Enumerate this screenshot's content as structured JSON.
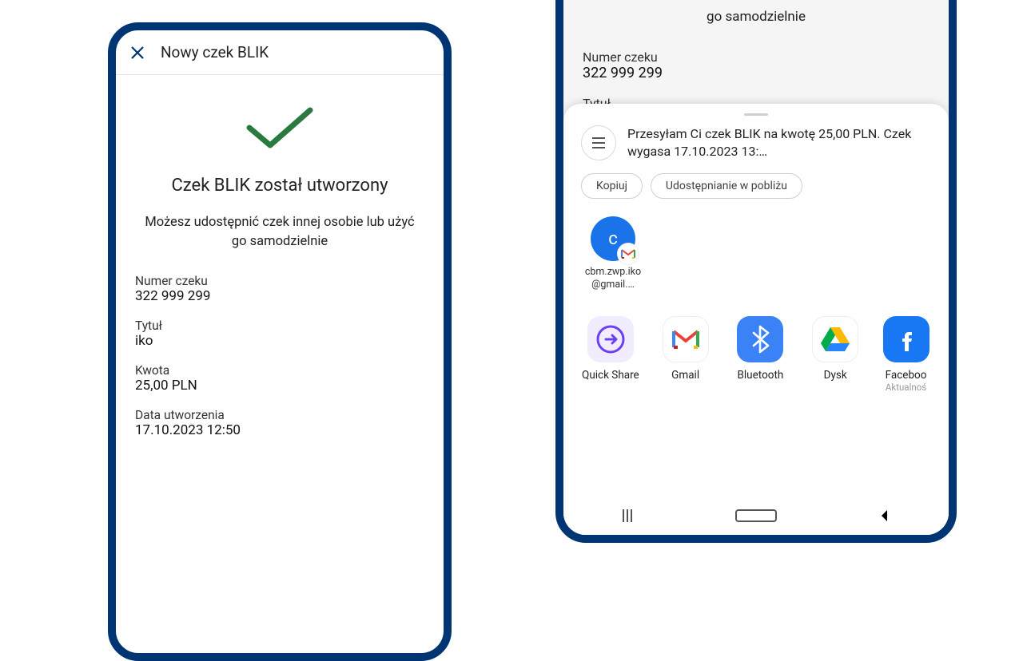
{
  "left": {
    "headerTitle": "Nowy czek BLIK",
    "mainTitle": "Czek BLIK został utworzony",
    "subtitle": "Możesz udostępnić czek innej osobie lub użyć go samodzielnie",
    "fields": {
      "checkNumberLabel": "Numer czeku",
      "checkNumberValue": "322 999 299",
      "titleLabel": "Tytuł",
      "titleValue": "iko",
      "amountLabel": "Kwota",
      "amountValue": "25,00 PLN",
      "createdLabel": "Data utworzenia",
      "createdValue": "17.10.2023 12:50"
    }
  },
  "right": {
    "bg": {
      "subtitle": "go samodzielnie",
      "checkNumberLabel": "Numer czeku",
      "checkNumberValue": "322 999 299",
      "titleLabel": "Tytuł"
    },
    "shareText": "Przesyłam Ci czek BLIK na kwotę 25,00 PLN. Czek wygasa 17.10.2023 13:…",
    "chips": {
      "copy": "Kopiuj",
      "nearby": "Udostępnianie w pobliżu"
    },
    "contact": {
      "initial": "c",
      "name": "cbm.zwp.iko@gmail.…"
    },
    "apps": {
      "quickshare": "Quick Share",
      "gmail": "Gmail",
      "bluetooth": "Bluetooth",
      "drive": "Dysk",
      "facebook": "Faceboo",
      "facebookSub": "Aktualnoś"
    }
  }
}
